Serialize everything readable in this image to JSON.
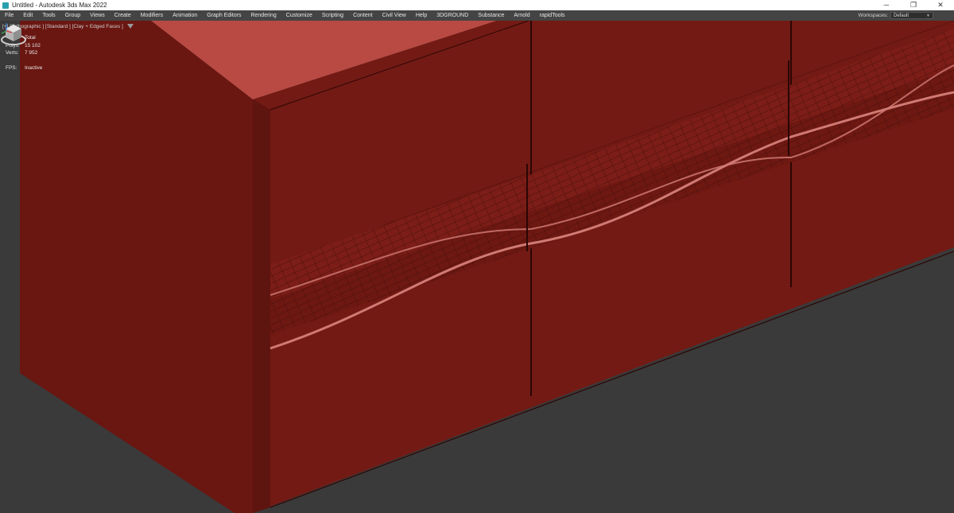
{
  "window": {
    "title": "Untitled - Autodesk 3ds Max 2022"
  },
  "menu": [
    "File",
    "Edit",
    "Tools",
    "Group",
    "Views",
    "Create",
    "Modifiers",
    "Animation",
    "Graph Editors",
    "Rendering",
    "Customize",
    "Scripting",
    "Content",
    "Civil View",
    "Help",
    "3DGROUND",
    "Substance",
    "Arnold",
    "rapidTools"
  ],
  "workspace": {
    "label": "Workspaces:",
    "value": "Default"
  },
  "viewport": {
    "label": "[+] [Orthographic ] [Standard ] [Clay + Edged Faces ]",
    "stats": {
      "total_label": "Total",
      "polys_label": "Polys:",
      "polys_value": "15 102",
      "verts_label": "Verts:",
      "verts_value": "7 952",
      "fps_label": "FPS:",
      "fps_value": "Inactive"
    }
  },
  "colors": {
    "clay": "#731a14",
    "clay_dark": "#5e140f",
    "clay_top": "#b84a43",
    "background": "#3a3a3a"
  },
  "icons": [
    "app-icon",
    "minimize-icon",
    "restore-icon",
    "close-icon",
    "filter-icon",
    "viewcube-icon",
    "axis-tripod-icon"
  ]
}
